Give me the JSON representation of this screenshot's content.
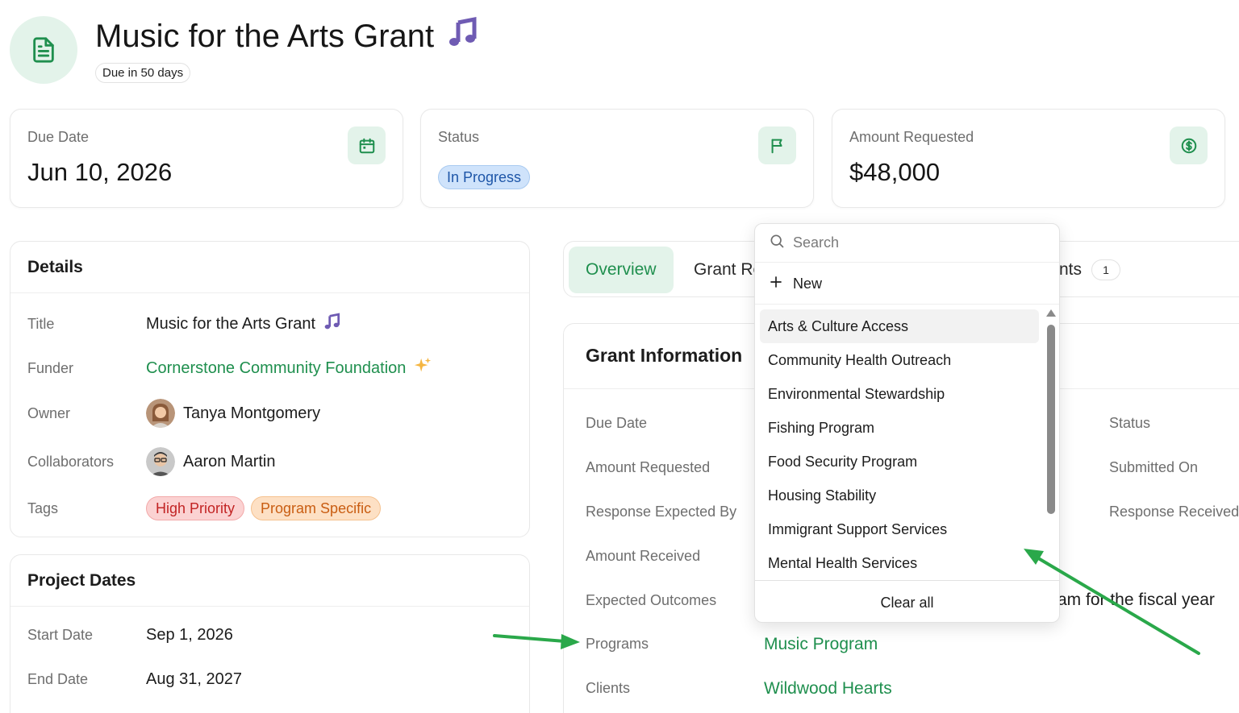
{
  "header": {
    "title": "Music for the Arts Grant",
    "title_emoji": "🎵",
    "due_badge": "Due in 50 days",
    "doc_icon": "document-icon"
  },
  "stats": {
    "due_date": {
      "label": "Due Date",
      "value": "Jun 10, 2026",
      "icon": "calendar-icon"
    },
    "status": {
      "label": "Status",
      "value": "In Progress",
      "icon": "flag-icon"
    },
    "amount": {
      "label": "Amount Requested",
      "value": "$48,000",
      "icon": "dollar-icon"
    }
  },
  "details": {
    "heading": "Details",
    "title_label": "Title",
    "title_value": "Music for the Arts Grant",
    "title_emoji": "🎵",
    "funder_label": "Funder",
    "funder_value": "Cornerstone Community Foundation",
    "funder_emoji": "✨",
    "owner_label": "Owner",
    "owner_value": "Tanya Montgomery",
    "collaborators_label": "Collaborators",
    "collaborators_value": "Aaron Martin",
    "tags_label": "Tags",
    "tags": [
      "High Priority",
      "Program Specific"
    ]
  },
  "project_dates": {
    "heading": "Project Dates",
    "start_label": "Start Date",
    "start_value": "Sep 1, 2026",
    "end_label": "End Date",
    "end_value": "Aug 31, 2027"
  },
  "tabs": {
    "overview": "Overview",
    "grant_partial": "Grant Re",
    "attachments_partial": "nts",
    "attachments_count": "1"
  },
  "grant_info": {
    "heading": "Grant Information",
    "labels_left": [
      "Due Date",
      "Amount Requested",
      "Response Expected By",
      "Amount Received",
      "Expected Outcomes",
      "Programs",
      "Clients"
    ],
    "labels_right": [
      "Status",
      "Submitted On",
      "Response Received"
    ],
    "outcomes_partial": "am for the fiscal year",
    "programs_value": "Music Program",
    "clients_value": "Wildwood Hearts"
  },
  "dropdown": {
    "search_placeholder": "Search",
    "new_label": "New",
    "options": [
      "Arts & Culture Access",
      "Community Health Outreach",
      "Environmental Stewardship",
      "Fishing Program",
      "Food Security Program",
      "Housing Stability",
      "Immigrant Support Services",
      "Mental Health Services"
    ],
    "clear_label": "Clear all"
  },
  "colors": {
    "accent_green": "#1f8f4e",
    "icon_bg": "#e3f3ea",
    "status_blue": "#1e56a8",
    "tag_red": "#c22424",
    "tag_orange": "#c95d12",
    "annotation_arrow": "#2aa84a"
  }
}
